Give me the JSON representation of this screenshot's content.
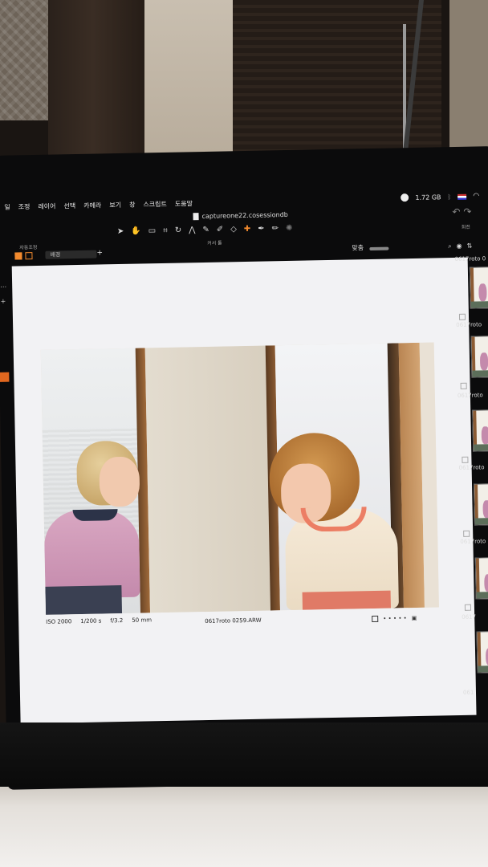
{
  "menubar": {
    "items": [
      "일",
      "조정",
      "레이어",
      "선택",
      "카메라",
      "보기",
      "창",
      "스크립트",
      "도움말"
    ],
    "memory": "1.72 GB"
  },
  "app": {
    "session_file": "captureone22.cosessiondb",
    "tool_caption": "커서 툴",
    "auto_adjust_label": "자동조정",
    "rotate_label": "회전",
    "background_select": "배경",
    "fit_label": "맞춤"
  },
  "viewer": {
    "iso": "ISO 2000",
    "shutter": "1/200 s",
    "aperture": "f/3.2",
    "focal_length": "50 mm",
    "filename": "0617roto 0259.ARW",
    "rating_dots": "• • • • •"
  },
  "filmstrip": {
    "labels": [
      "0617roto 0",
      "0617roto",
      "0617roto",
      "0617roto",
      "0617roto",
      "0617",
      "061"
    ]
  },
  "icons": {
    "toolbar": [
      "select-cursor-icon",
      "pan-icon",
      "loupe-icon",
      "crop-icon",
      "rotate-icon",
      "keystone-icon",
      "color-picker-icon",
      "brush-icon",
      "eraser-icon",
      "heal-icon",
      "clone-icon",
      "annotate-icon",
      "settings-icon"
    ]
  },
  "colors": {
    "accent": "#f28a2e"
  }
}
